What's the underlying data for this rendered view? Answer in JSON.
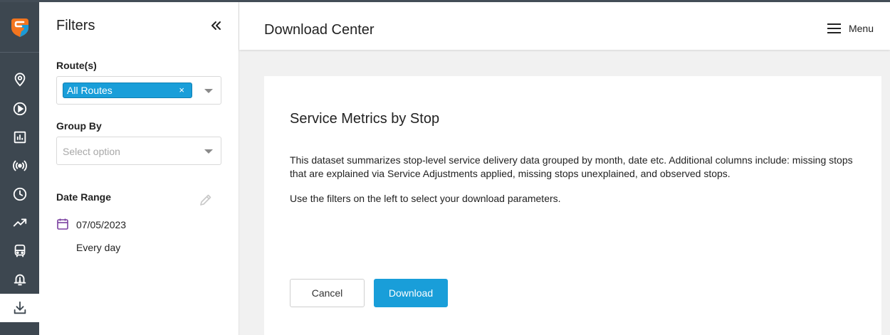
{
  "header": {
    "page_title": "Download Center",
    "menu_label": "Menu"
  },
  "rail": {
    "items": [
      {
        "icon": "map-pin-icon"
      },
      {
        "icon": "play-circle-icon"
      },
      {
        "icon": "bar-chart-icon"
      },
      {
        "icon": "broadcast-icon"
      },
      {
        "icon": "clock-icon"
      },
      {
        "icon": "trending-up-icon"
      },
      {
        "icon": "bus-icon"
      },
      {
        "icon": "alert-bell-icon"
      },
      {
        "icon": "download-icon",
        "active": true
      }
    ]
  },
  "filters": {
    "title": "Filters",
    "routes": {
      "label": "Route(s)",
      "selected_chip": "All Routes",
      "chip_remove": "×"
    },
    "group_by": {
      "label": "Group By",
      "placeholder": "Select option"
    },
    "date_range": {
      "label": "Date Range",
      "date": "07/05/2023",
      "frequency": "Every day"
    }
  },
  "card": {
    "title": "Service Metrics by Stop",
    "description": "This dataset summarizes stop-level service delivery data grouped by month, date etc. Additional columns include: missing stops that are explained via Service Adjustments applied, missing stops unexplained, and observed stops.",
    "hint": "Use the filters on the left to select your download parameters.",
    "cancel_label": "Cancel",
    "download_label": "Download"
  },
  "colors": {
    "rail_bg": "#3d4750",
    "accent": "#199ed9",
    "logo_orange": "#f3751f",
    "logo_blue": "#1b9ad6",
    "calendar_purple": "#7a3fa0"
  }
}
